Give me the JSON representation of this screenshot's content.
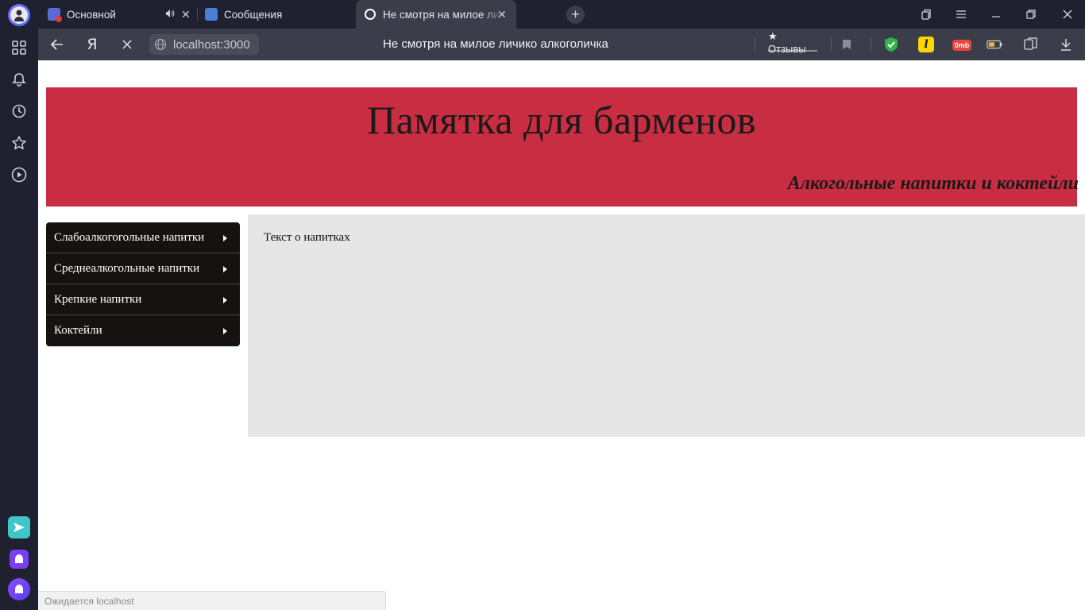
{
  "browser": {
    "tabs": [
      {
        "label": "Основной",
        "favicon_color": "#5b6bd6",
        "has_audio": true
      },
      {
        "label": "Сообщения",
        "favicon_color": "#4a7fd9"
      },
      {
        "label": "Не смотря на милое ли",
        "active": true
      }
    ],
    "address": {
      "url": "localhost:3000",
      "page_title": "Не смотря на милое личико алкоголичка",
      "reviews_label": "★ Отзывы",
      "yandex_glyph": "Я"
    },
    "extensions": {
      "traffic_badge": "0mb"
    },
    "status_text": "Ожидается localhost"
  },
  "page": {
    "title": "Памятка для барменов",
    "subtitle": "Алкогольные напитки и коктейли",
    "menu": [
      {
        "label": "Слабоалкогогольные напитки"
      },
      {
        "label": "Среднеалкогольные напитки"
      },
      {
        "label": "Крепкие напитки"
      },
      {
        "label": "Коктейли"
      }
    ],
    "content_text": "Текст о напитках"
  },
  "colors": {
    "header_bg": "#c92d42",
    "menu_bg": "#161212",
    "content_bg": "#e6e6e6",
    "browser_chrome": "#1f2130"
  }
}
